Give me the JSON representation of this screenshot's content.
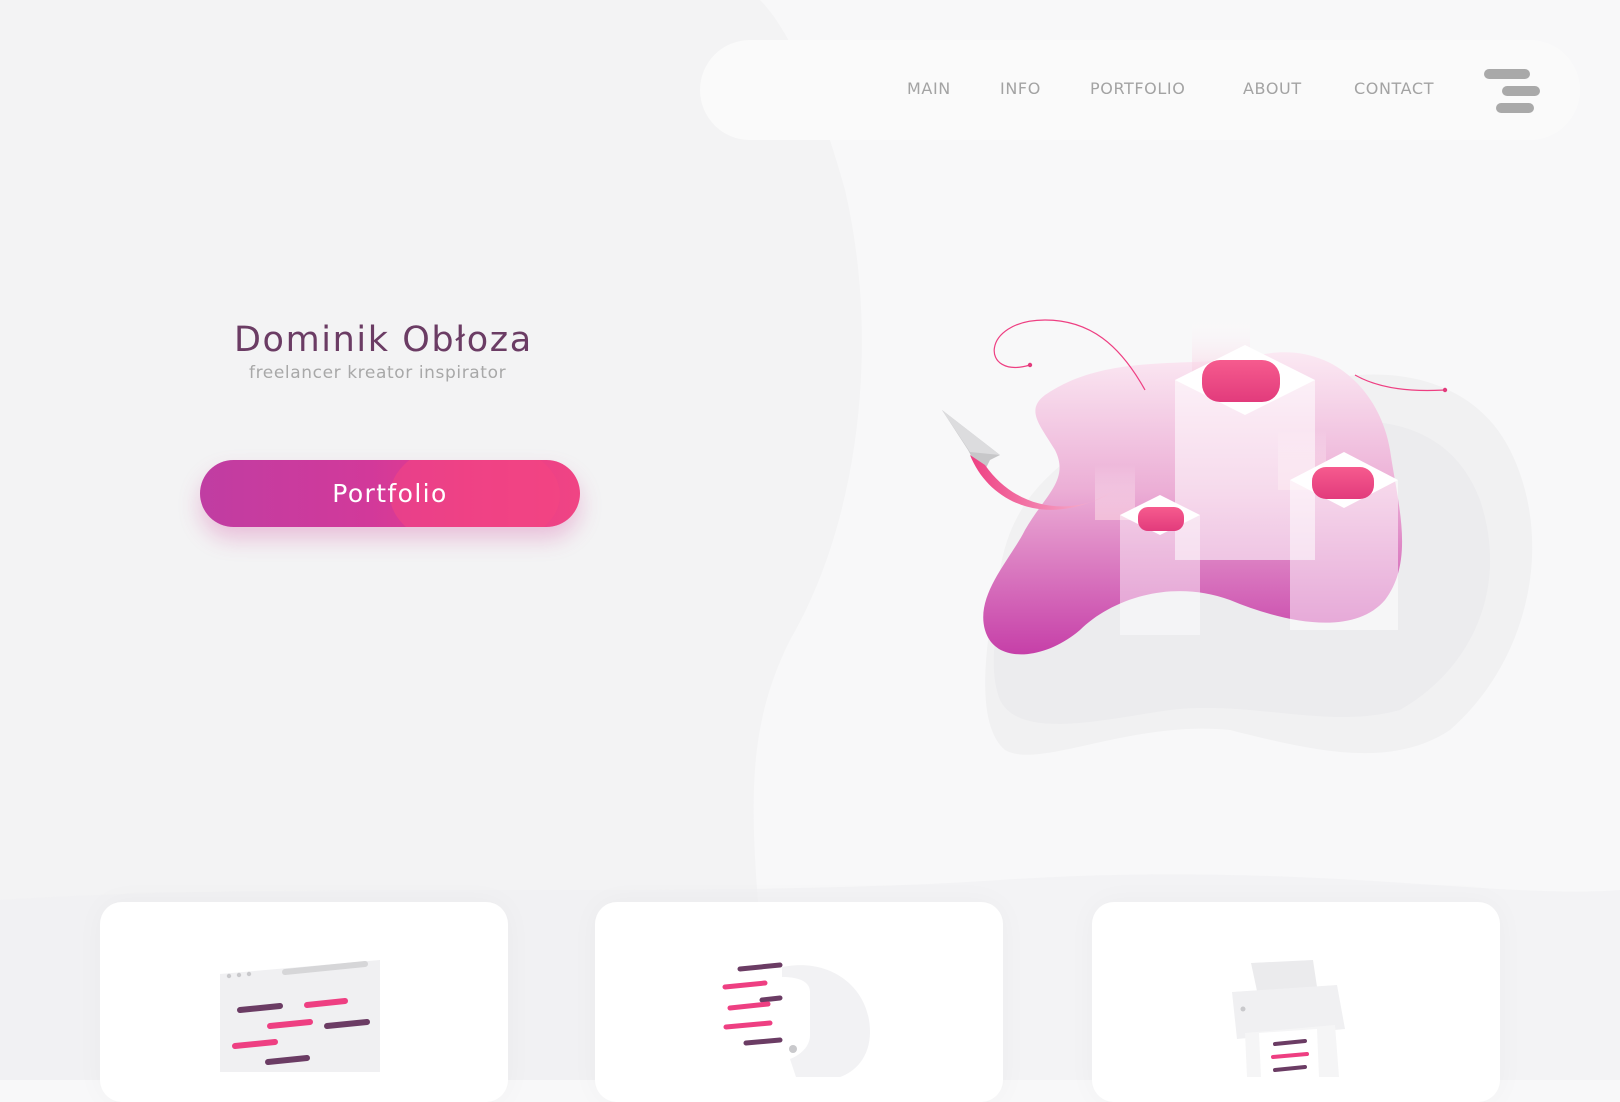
{
  "nav": {
    "items": [
      {
        "label": "MAIN"
      },
      {
        "label": "INFO"
      },
      {
        "label": "PORTFOLIO"
      },
      {
        "label": "ABOUT"
      },
      {
        "label": "CONTACT"
      }
    ],
    "menu_icon": "hamburger-menu-icon"
  },
  "hero": {
    "name": "Dominik Obłoza",
    "tagline": "freelancer kreator inspirator",
    "cta_label": "Portfolio",
    "illustration_icon": "isometric-blob-towers-illustration"
  },
  "features": [
    {
      "icon": "browser-code-icon"
    },
    {
      "icon": "brain-code-icon"
    },
    {
      "icon": "printer-icon"
    }
  ],
  "colors": {
    "background": "#f8f8f9",
    "accent_magenta": "#c03da2",
    "accent_pink": "#f04484",
    "heading_purple": "#6b3c64",
    "nav_text": "#a3a3a3",
    "muted_text": "#a8a8a8"
  }
}
